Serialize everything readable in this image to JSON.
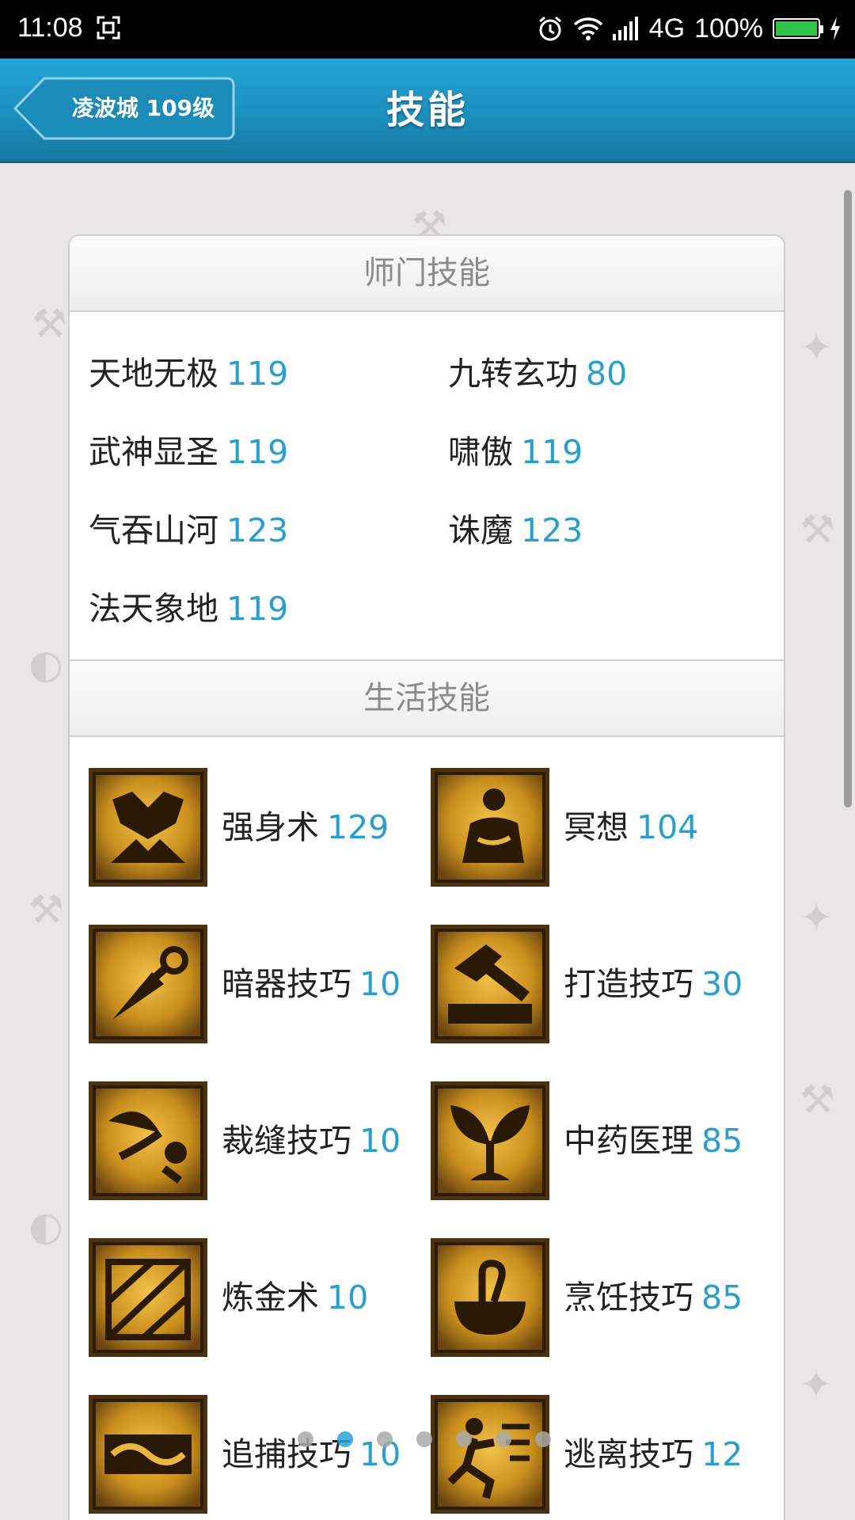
{
  "status_bar": {
    "time": "11:08",
    "network": "4G",
    "battery_percent_text": "100%",
    "battery_level": 1.0,
    "battery_color": "#2fc54a"
  },
  "header": {
    "back_label": "凌波城 109级",
    "title": "技能",
    "accent_color": "#1b8fbe"
  },
  "sect_skills": {
    "title": "师门技能",
    "items": [
      {
        "name": "天地无极",
        "level": "119"
      },
      {
        "name": "九转玄功",
        "level": "80"
      },
      {
        "name": "武神显圣",
        "level": "119"
      },
      {
        "name": "啸傲",
        "level": "119"
      },
      {
        "name": "气吞山河",
        "level": "123"
      },
      {
        "name": "诛魔",
        "level": "123"
      },
      {
        "name": "法天象地",
        "level": "119"
      }
    ]
  },
  "life_skills": {
    "title": "生活技能",
    "items": [
      {
        "name": "强身术",
        "level": "129",
        "icon": "strength-icon"
      },
      {
        "name": "冥想",
        "level": "104",
        "icon": "meditation-icon"
      },
      {
        "name": "暗器技巧",
        "level": "10",
        "icon": "dart-icon"
      },
      {
        "name": "打造技巧",
        "level": "30",
        "icon": "hammer-anvil-icon"
      },
      {
        "name": "裁缝技巧",
        "level": "10",
        "icon": "scissors-icon"
      },
      {
        "name": "中药医理",
        "level": "85",
        "icon": "herb-icon"
      },
      {
        "name": "炼金术",
        "level": "10",
        "icon": "alchemy-icon"
      },
      {
        "name": "烹饪技巧",
        "level": "85",
        "icon": "cooking-pot-icon"
      },
      {
        "name": "追捕技巧",
        "level": "10",
        "icon": "chain-icon"
      },
      {
        "name": "逃离技巧",
        "level": "12",
        "icon": "escape-icon"
      }
    ]
  },
  "pager": {
    "count": 7,
    "active_index": 1
  }
}
